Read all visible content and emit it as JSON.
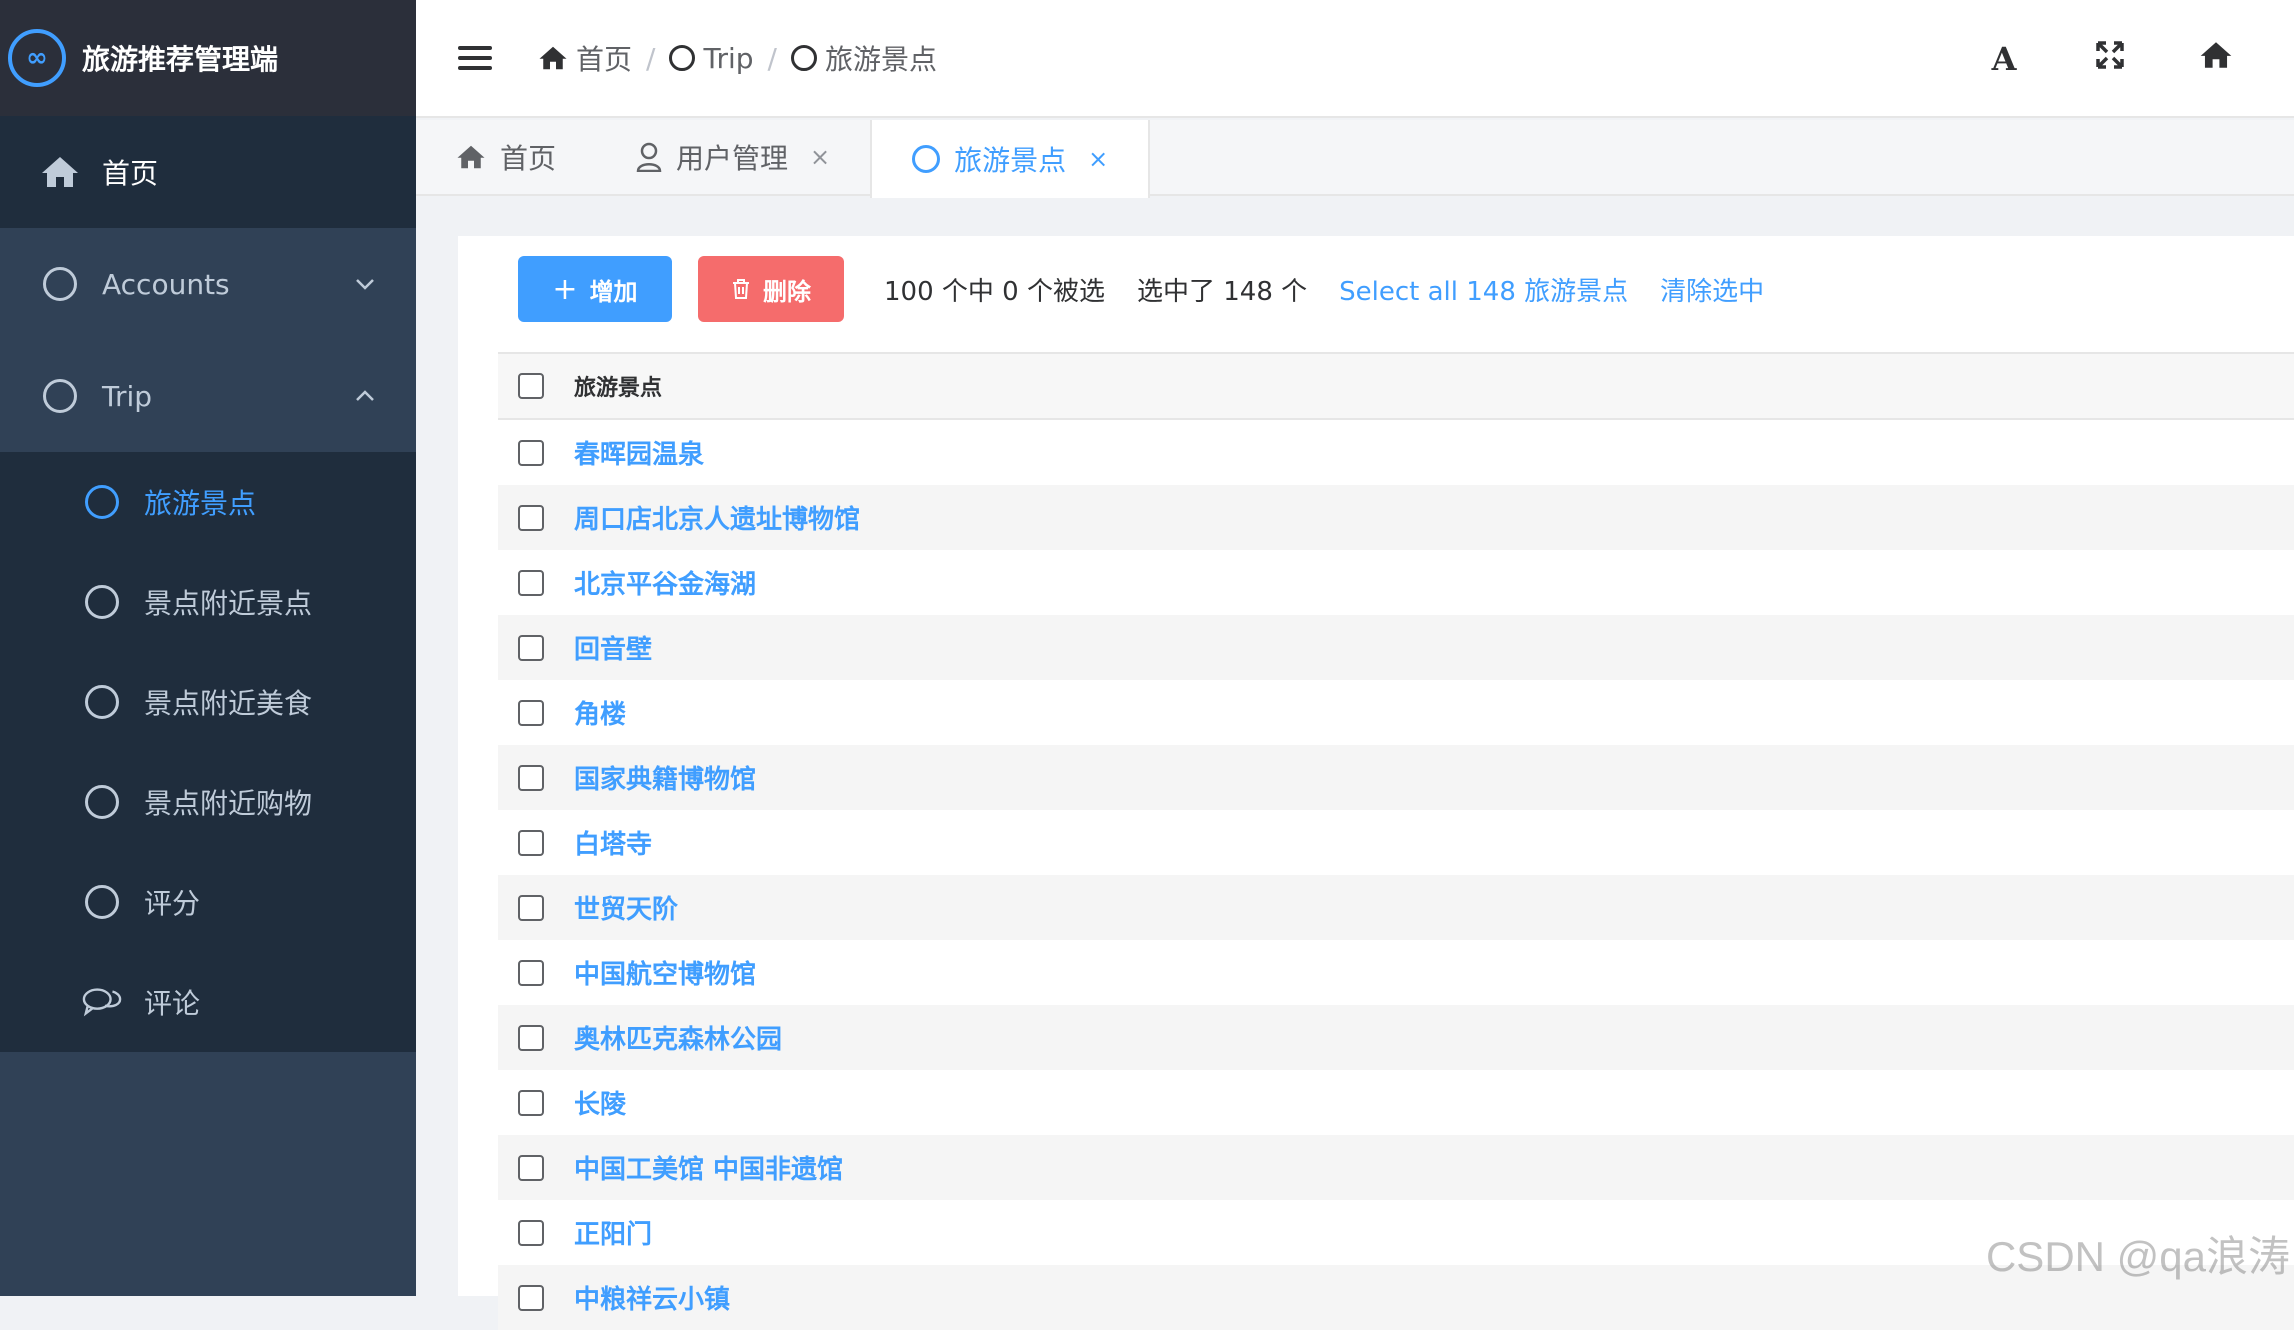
{
  "app": {
    "title": "旅游推荐管理端",
    "logo_icon": "infinity-icon"
  },
  "sidebar": {
    "home": "首页",
    "accounts": "Accounts",
    "trip": "Trip",
    "trip_items": [
      "旅游景点",
      "景点附近景点",
      "景点附近美食",
      "景点附近购物",
      "评分",
      "评论"
    ]
  },
  "breadcrumb": {
    "home": "首页",
    "sep1": "/",
    "trip": "Trip",
    "sep2": "/",
    "current": "旅游景点"
  },
  "navbar": {
    "font_btn": "A",
    "fullscreen_btn": "⤢",
    "home_btn": "⌂"
  },
  "tags": {
    "home": "首页",
    "users": "用户管理",
    "attractions": "旅游景点",
    "close": "×"
  },
  "toolbar": {
    "add_label": "增加",
    "delete_label": "删除",
    "selection_info": "100 个中 0 个被选",
    "selected_count": "选中了 148 个",
    "select_all": "Select all 148 旅游景点",
    "clear_selection": "清除选中"
  },
  "table": {
    "header": "旅游景点",
    "rows": [
      "春晖园温泉",
      "周口店北京人遗址博物馆",
      "北京平谷金海湖",
      "回音壁",
      "角楼",
      "国家典籍博物馆",
      "白塔寺",
      "世贸天阶",
      "中国航空博物馆",
      "奥林匹克森林公园",
      "长陵",
      "中国工美馆 中国非遗馆",
      "正阳门",
      "中粮祥云小镇"
    ]
  },
  "watermark": "CSDN @qa浪涛",
  "colors": {
    "accent": "#409eff",
    "danger": "#f56c6c",
    "sidebar_bg": "#304156",
    "sidebar_dark": "#1f2d3d"
  }
}
